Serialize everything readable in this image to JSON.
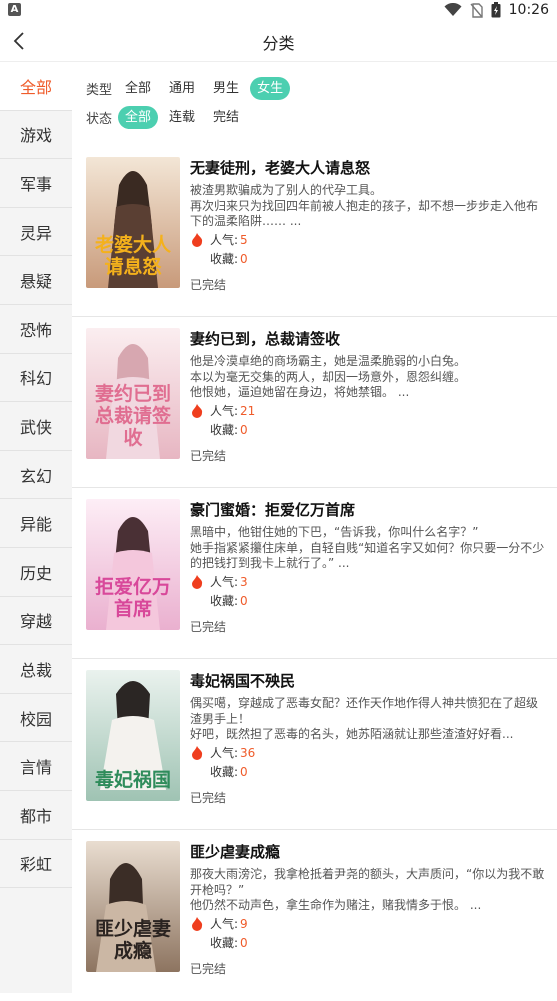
{
  "status_bar": {
    "app_badge": "A",
    "time": "10:26"
  },
  "header": {
    "title": "分类"
  },
  "sidebar": {
    "items": [
      {
        "label": "全部",
        "active": true
      },
      {
        "label": "游戏"
      },
      {
        "label": "军事"
      },
      {
        "label": "灵异"
      },
      {
        "label": "悬疑"
      },
      {
        "label": "恐怖"
      },
      {
        "label": "科幻"
      },
      {
        "label": "武侠"
      },
      {
        "label": "玄幻"
      },
      {
        "label": "异能"
      },
      {
        "label": "历史"
      },
      {
        "label": "穿越"
      },
      {
        "label": "总裁"
      },
      {
        "label": "校园"
      },
      {
        "label": "言情"
      },
      {
        "label": "都市"
      },
      {
        "label": "彩虹"
      }
    ]
  },
  "filters": {
    "type": {
      "label": "类型",
      "options": [
        "全部",
        "通用",
        "男生",
        "女生"
      ],
      "selected": "女生"
    },
    "status": {
      "label": "状态",
      "options": [
        "全部",
        "连载",
        "完结"
      ],
      "selected": "全部"
    }
  },
  "books": [
    {
      "title": "无妻徒刑，老婆大人请息怒",
      "desc": "被渣男欺骗成为了别人的代孕工具。\n再次归来只为找回四年前被人抱走的孩子，却不想一步步走入他布下的温柔陷阱…… ...",
      "popularity_label": "人气:",
      "popularity": "5",
      "favorites_label": "收藏:",
      "favorites": "0",
      "state": "已完结",
      "cover_text": "老婆大人请息怒",
      "cover_colors": [
        "#f3e6d6",
        "#c89a7a"
      ],
      "cover_text_color": "#f4b11c"
    },
    {
      "title": "妻约已到，总裁请签收",
      "desc": "他是冷漠卓绝的商场霸主，她是温柔脆弱的小白兔。\n本以为毫无交集的两人，却因一场意外，恩怨纠缠。\n他恨她，逼迫她留在身边，将她禁锢。 ...",
      "popularity_label": "人气:",
      "popularity": "21",
      "favorites_label": "收藏:",
      "favorites": "0",
      "state": "已完结",
      "cover_text": "妻约已到总裁请签收",
      "cover_colors": [
        "#fbeef0",
        "#e7b6c2"
      ],
      "cover_text_color": "#e06e91"
    },
    {
      "title": "豪门蜜婚：拒爱亿万首席",
      "desc": "黑暗中，他钳住她的下巴，“告诉我，你叫什么名字？”\n她手指紧紧攥住床单，自轻自贱“知道名字又如何？你只要一分不少的把钱打到我卡上就行了。” ...",
      "popularity_label": "人气:",
      "popularity": "3",
      "favorites_label": "收藏:",
      "favorites": "0",
      "state": "已完结",
      "cover_text": "拒爱亿万首席",
      "cover_colors": [
        "#fdeef6",
        "#eab0cf"
      ],
      "cover_text_color": "#d8489a"
    },
    {
      "title": "毒妃祸国不殃民",
      "desc": "偶买噶，穿越成了恶毒女配？还作天作地作得人神共愤犯在了超级渣男手上！\n    好吧，既然担了恶毒的名头，她苏陌涵就让那些渣渣好好看...",
      "popularity_label": "人气:",
      "popularity": "36",
      "favorites_label": "收藏:",
      "favorites": "0",
      "state": "已完结",
      "cover_text": "毒妃祸国",
      "cover_colors": [
        "#eaf2ee",
        "#9fc3b3"
      ],
      "cover_text_color": "#2f8c5b"
    },
    {
      "title": "匪少虐妻成瘾",
      "desc": "那夜大雨滂沱，我拿枪抵着尹尧的额头，大声质问，“你以为我不敢开枪吗？”\n    他仍然不动声色，拿生命作为赌注，赌我情多于恨。 ...",
      "popularity_label": "人气:",
      "popularity": "9",
      "favorites_label": "收藏:",
      "favorites": "0",
      "state": "已完结",
      "cover_text": "匪少虐妻成瘾",
      "cover_colors": [
        "#e9ddd0",
        "#8d7460"
      ],
      "cover_text_color": "#2a2320"
    }
  ]
}
